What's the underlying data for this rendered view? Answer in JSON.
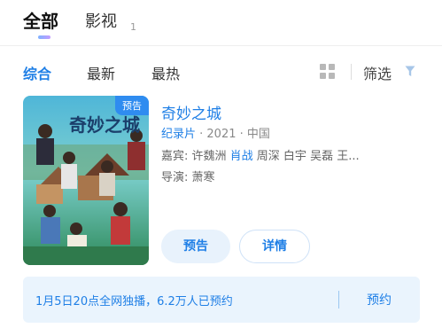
{
  "top_tabs": {
    "all": "全部",
    "video": "影视",
    "video_count": "1"
  },
  "sort": {
    "items": [
      "综合",
      "最新",
      "最热"
    ],
    "active_index": 0,
    "filter_label": "筛选"
  },
  "result": {
    "badge": "预告",
    "title": "奇妙之城",
    "genre": "纪录片",
    "meta_rest": " · 2021 · 中国",
    "cast_label": "嘉宾: ",
    "cast_before": "许魏洲 ",
    "cast_highlight": "肖战",
    "cast_after": " 周深 白宇 吴磊 王...",
    "director": "导演: 萧寒",
    "trailer_button": "预告",
    "detail_button": "详情"
  },
  "notice": {
    "text": "1月5日20点全网独播，6.2万人已预约",
    "reserve": "预约"
  },
  "colors": {
    "accent": "#1f7fe6",
    "notice_bg": "#eaf4fd",
    "badge_bg": "#2f8cf0"
  },
  "icons": {
    "grid": "grid-view-icon",
    "filter": "funnel-icon"
  }
}
